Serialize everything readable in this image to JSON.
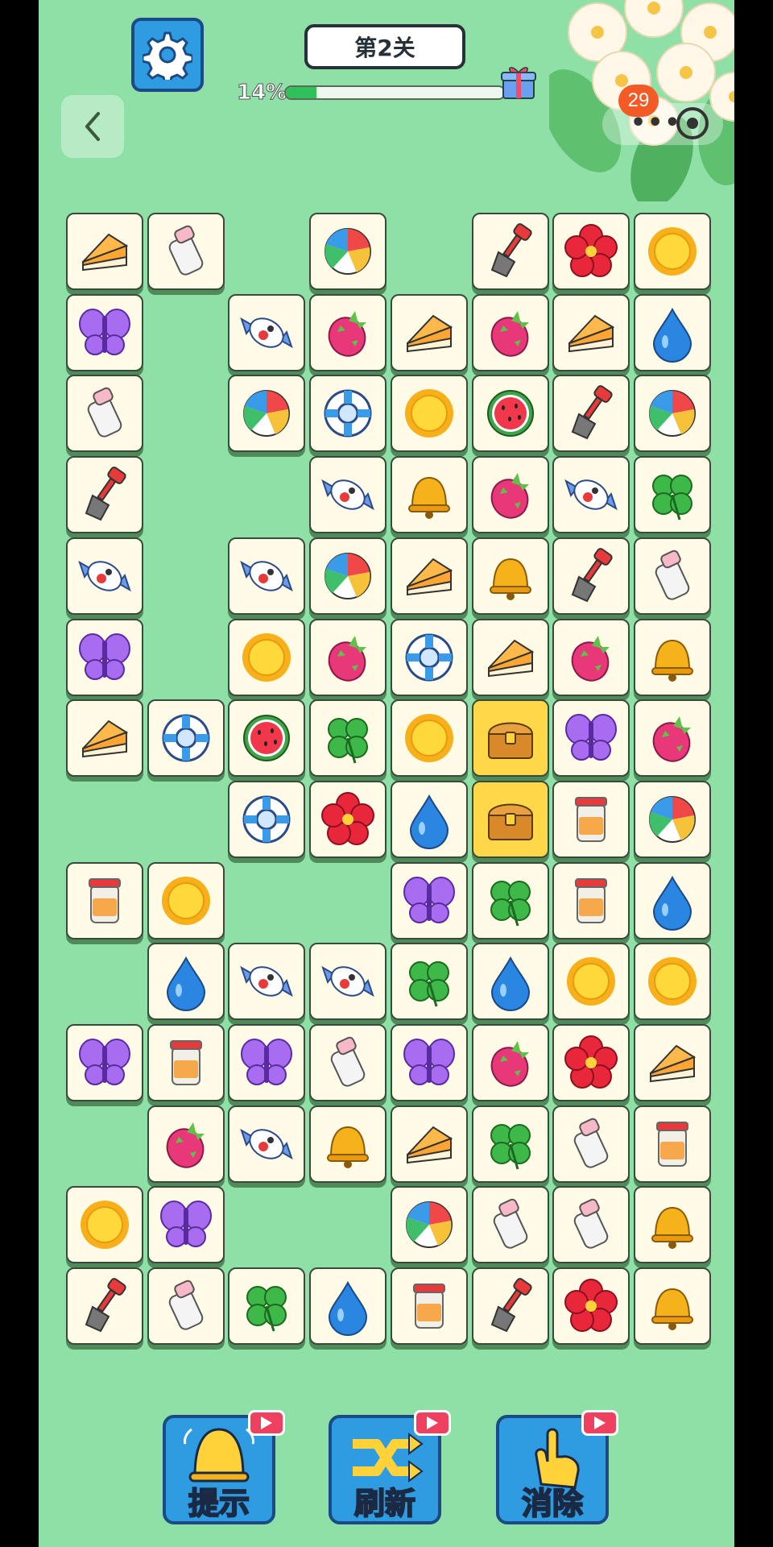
{
  "header": {
    "level_label": "第2关",
    "progress_text": "14%",
    "progress_value": 0.14,
    "notification_count": "29"
  },
  "colors": {
    "background": "#8fe0a7",
    "tile_face": "#fffbe6",
    "tile_selected": "#ffd84a",
    "button_blue": "#2f9be0",
    "progress_green": "#2fc05a"
  },
  "board": {
    "rows": [
      [
        "cake",
        "milk",
        null,
        "ball",
        null,
        "shovel",
        "flower",
        "sun"
      ],
      [
        "butterfly",
        null,
        "candy",
        "dragonfruit",
        "cake",
        "dragonfruit",
        "cake",
        "drop"
      ],
      [
        "milk",
        null,
        "ball",
        "lifebuoy",
        "sun",
        "watermelon",
        "shovel",
        "ball"
      ],
      [
        "shovel",
        null,
        null,
        "candy",
        "bell",
        "dragonfruit",
        "candy",
        "clover"
      ],
      [
        "candy",
        null,
        "candy",
        "ball",
        "cake",
        "bell",
        "shovel",
        "milk"
      ],
      [
        "butterfly",
        null,
        "sun",
        "dragonfruit",
        "lifebuoy",
        "cake",
        "dragonfruit",
        "bell"
      ],
      [
        "cake",
        "lifebuoy",
        "watermelon",
        "clover",
        "sun",
        "chest",
        "butterfly",
        "dragonfruit"
      ],
      [
        null,
        null,
        "lifebuoy",
        "flower",
        "drop",
        "chest",
        "jar",
        "ball"
      ],
      [
        "jar",
        "sun",
        null,
        null,
        "butterfly",
        "clover",
        "jar",
        "drop"
      ],
      [
        null,
        "drop",
        "candy",
        "candy",
        "clover",
        "drop",
        "sun",
        "sun"
      ],
      [
        "butterfly",
        "jar",
        "butterfly",
        "milk",
        "butterfly",
        "dragonfruit",
        "flower",
        "cake"
      ],
      [
        null,
        "dragonfruit",
        "candy",
        "bell",
        "cake",
        "clover",
        "milk",
        "jar"
      ],
      [
        "sun",
        "butterfly",
        null,
        null,
        "ball",
        "milk",
        "milk",
        "bell"
      ],
      [
        "shovel",
        "milk",
        "clover",
        "drop",
        "jar",
        "shovel",
        "flower",
        "bell"
      ]
    ],
    "selected": [
      [
        6,
        5
      ],
      [
        7,
        5
      ]
    ]
  },
  "powerups": [
    {
      "name": "hint",
      "label": "提示",
      "icon": "bell-icon"
    },
    {
      "name": "shuffle",
      "label": "刷新",
      "icon": "shuffle-icon"
    },
    {
      "name": "remove",
      "label": "消除",
      "icon": "hand-icon"
    }
  ]
}
